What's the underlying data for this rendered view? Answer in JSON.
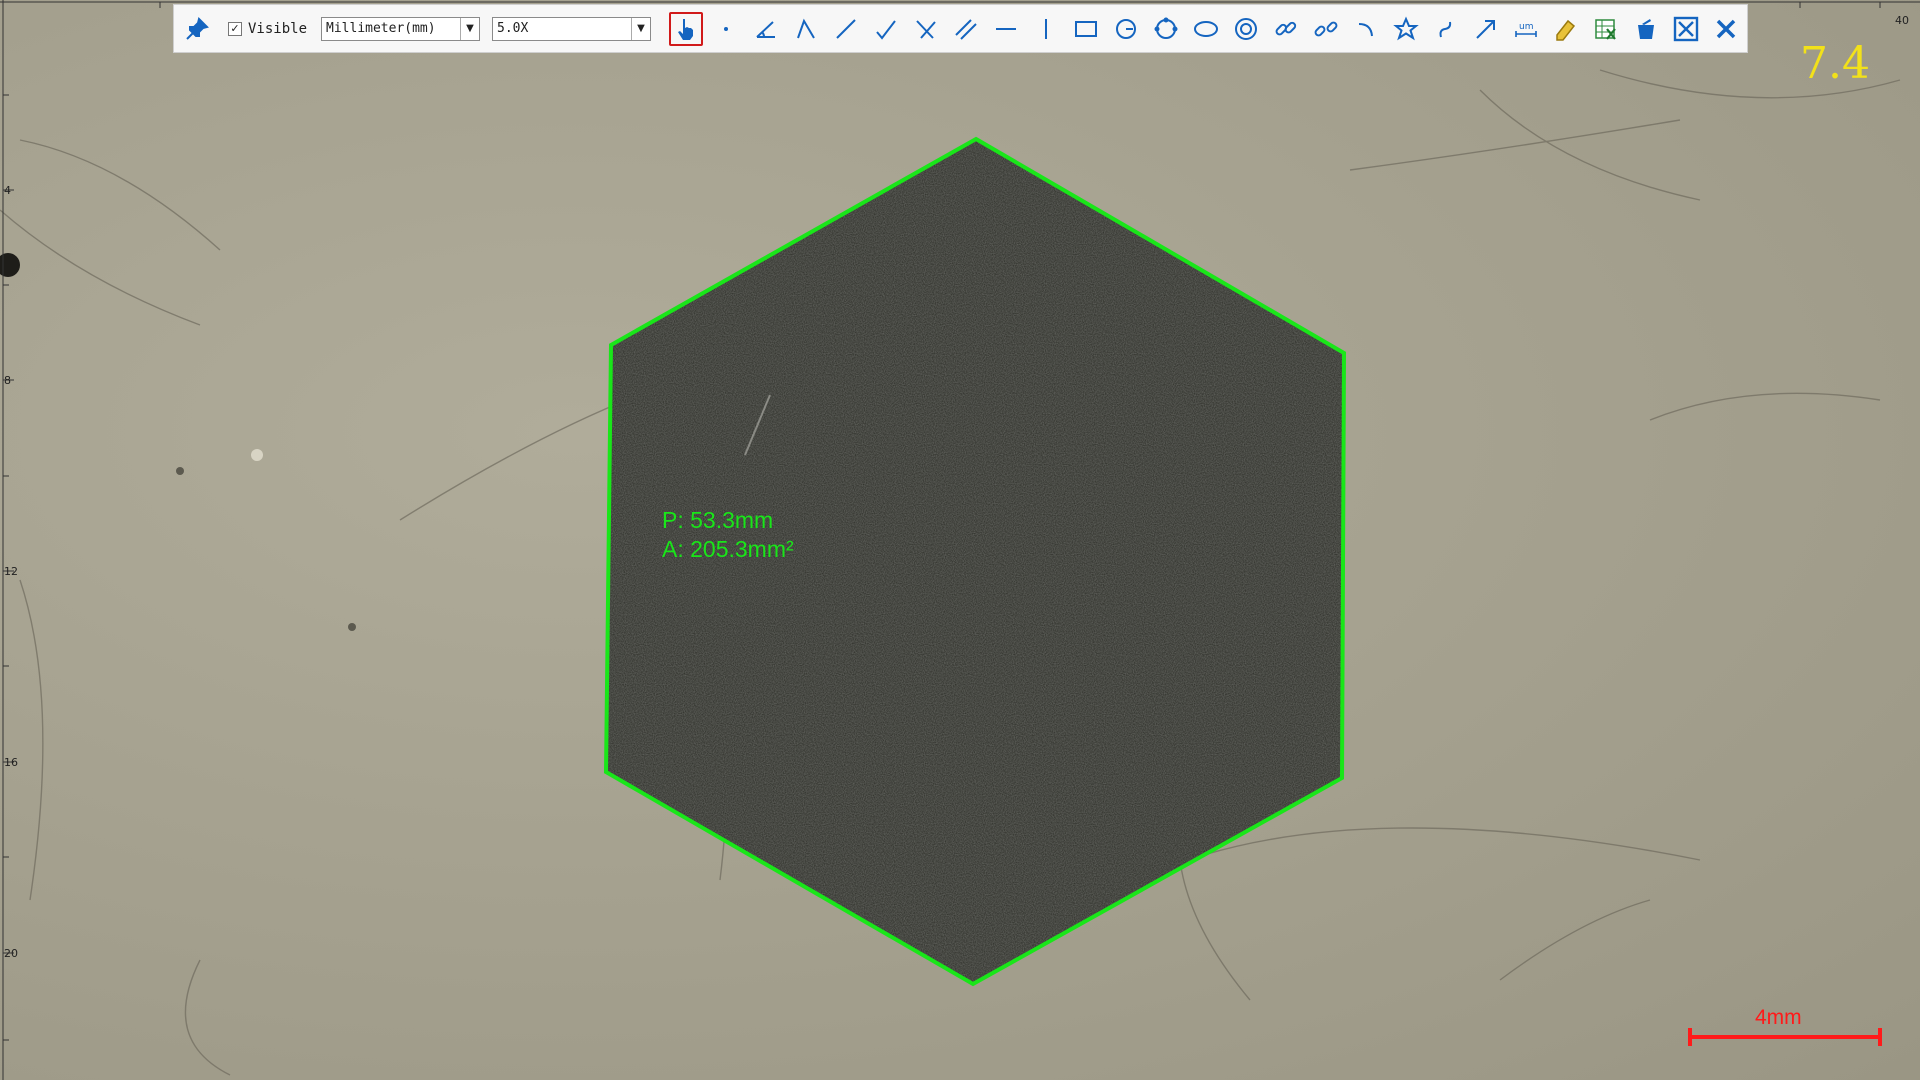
{
  "toolbar": {
    "visible_label": "Visible",
    "visible_checked": "✓",
    "unit_select": "Millimeter(mm)",
    "zoom_select": "5.0X",
    "icons": [
      "pin-icon",
      "hand-pointer-icon",
      "point-icon",
      "angle-icon",
      "angle-open-icon",
      "line-icon",
      "polyline-icon",
      "cross-lines-icon",
      "parallel-lines-icon",
      "horizontal-line-icon",
      "vertical-line-icon",
      "rectangle-icon",
      "circle-center-icon",
      "circle-icon",
      "ellipse-icon",
      "concentric-circle-icon",
      "link-icon",
      "chain-link-icon",
      "arc-icon",
      "star-icon",
      "curve-icon",
      "arrow-icon",
      "scale-bar-icon",
      "pencil-icon",
      "export-excel-icon",
      "delete-icon",
      "close-box-icon",
      "close-icon"
    ]
  },
  "overlay": {
    "zoom_readout": "7.4",
    "perimeter": "P: 53.3mm",
    "area": "A: 205.3mm²",
    "scale_label": "4mm",
    "ruler_top_label": "40",
    "ruler_left": [
      "4",
      "8",
      "12",
      "16",
      "20"
    ]
  },
  "colors": {
    "measure_green": "#19e619",
    "scale_red": "#ff1a1a",
    "zoom_yellow": "#f2e11a",
    "toolbar_blue": "#1565c0"
  }
}
